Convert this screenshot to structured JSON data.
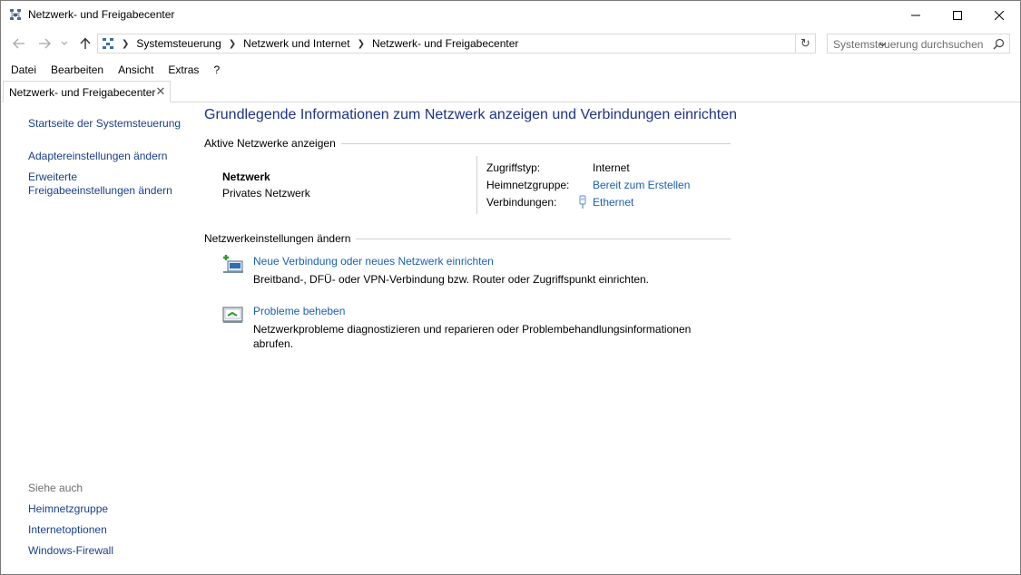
{
  "window": {
    "title": "Netzwerk- und Freigabecenter"
  },
  "address": {
    "crumbs": [
      "Systemsteuerung",
      "Netzwerk und Internet",
      "Netzwerk- und Freigabecenter"
    ],
    "search_placeholder": "Systemsteuerung durchsuchen"
  },
  "menu": {
    "items": [
      "Datei",
      "Bearbeiten",
      "Ansicht",
      "Extras",
      "?"
    ]
  },
  "tab": {
    "label": "Netzwerk- und Freigabecenter"
  },
  "sidebar": {
    "links": [
      "Startseite der Systemsteuerung",
      "Adaptereinstellungen ändern",
      "Erweiterte Freigabeeinstellungen ändern"
    ],
    "see_also_title": "Siehe auch",
    "see_also": [
      "Heimnetzgruppe",
      "Internetoptionen",
      "Windows-Firewall"
    ]
  },
  "main": {
    "heading": "Grundlegende Informationen zum Netzwerk anzeigen und Verbindungen einrichten",
    "active_networks_title": "Aktive Netzwerke anzeigen",
    "network": {
      "name": "Netzwerk",
      "type": "Privates Netzwerk",
      "access_label": "Zugriffstyp:",
      "access_value": "Internet",
      "homegroup_label": "Heimnetzgruppe:",
      "homegroup_value": "Bereit zum Erstellen",
      "connections_label": "Verbindungen:",
      "connections_value": "Ethernet"
    },
    "change_settings_title": "Netzwerkeinstellungen ändern",
    "tasks": [
      {
        "title": "Neue Verbindung oder neues Netzwerk einrichten",
        "description": "Breitband-, DFÜ- oder VPN-Verbindung bzw. Router oder Zugriffspunkt einrichten."
      },
      {
        "title": "Probleme beheben",
        "description": "Netzwerkprobleme diagnostizieren und reparieren oder Problembehandlungsinformationen abrufen."
      }
    ]
  },
  "colors": {
    "heading": "#1e3287",
    "link": "#1a5fb4",
    "sidebar_link": "#1a3f8a"
  }
}
